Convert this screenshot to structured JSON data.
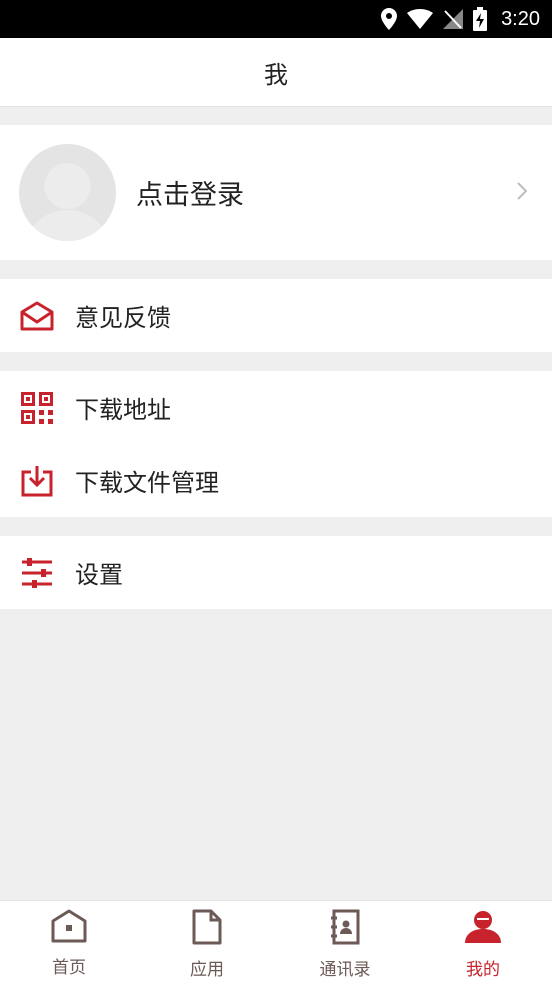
{
  "status_bar": {
    "time": "3:20",
    "icons": [
      "location-icon",
      "wifi-icon",
      "no-signal-icon",
      "battery-charging-icon"
    ]
  },
  "header": {
    "title": "我"
  },
  "profile": {
    "login_label": "点击登录"
  },
  "menu": {
    "feedback": {
      "label": "意见反馈",
      "icon": "mail-icon"
    },
    "download_address": {
      "label": "下载地址",
      "icon": "qr-code-icon"
    },
    "download_file_manager": {
      "label": "下载文件管理",
      "icon": "download-icon"
    },
    "settings": {
      "label": "设置",
      "icon": "sliders-icon"
    }
  },
  "tabs": [
    {
      "label": "首页",
      "icon": "home-icon",
      "active": false
    },
    {
      "label": "应用",
      "icon": "document-icon",
      "active": false
    },
    {
      "label": "通讯录",
      "icon": "contacts-icon",
      "active": false
    },
    {
      "label": "我的",
      "icon": "user-icon",
      "active": true
    }
  ],
  "colors": {
    "accent": "#c8232c",
    "tab_inactive": "#6b5a55",
    "background": "#efefef"
  }
}
